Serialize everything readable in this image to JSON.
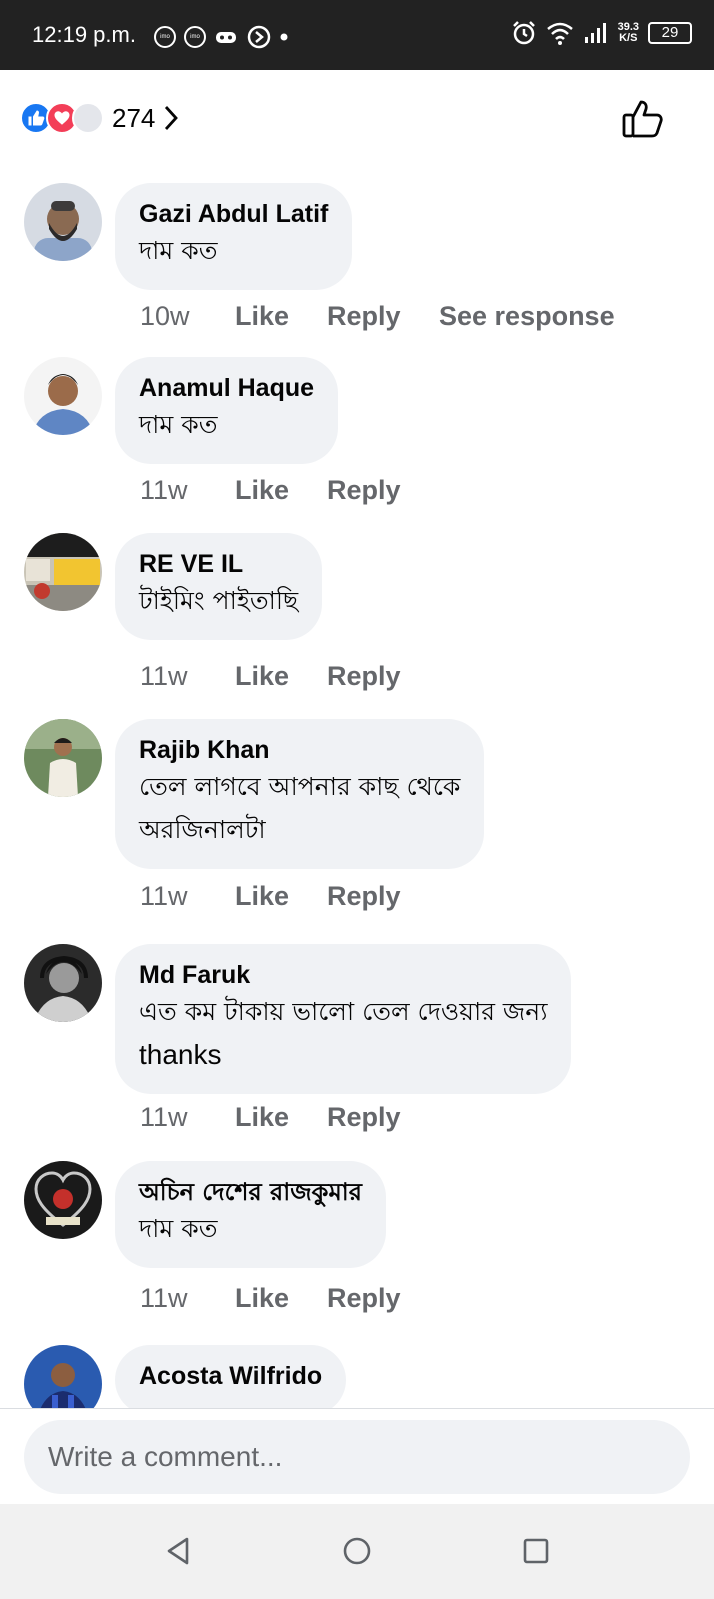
{
  "status_bar": {
    "time": "12:19 p.m.",
    "notif_icon_1": "imo",
    "notif_icon_2": "imo",
    "speed_top": "39.3",
    "speed_bottom": "K/S",
    "battery": "29",
    "icons": [
      "alarm-icon",
      "wifi-icon",
      "signal-icon",
      "battery-icon"
    ]
  },
  "reactions": {
    "count": "274",
    "types": [
      "like",
      "love"
    ]
  },
  "comments": [
    {
      "name": "Gazi Abdul Latif",
      "lines": [
        "দাম কত"
      ],
      "time": "10w",
      "like": "Like",
      "reply": "Reply",
      "see_response": "See response"
    },
    {
      "name": "Anamul Haque",
      "lines": [
        "দাম কত"
      ],
      "time": "11w",
      "like": "Like",
      "reply": "Reply"
    },
    {
      "name": "RE VE IL",
      "lines": [
        "টাইমিং পাইতাছি"
      ],
      "time": "11w",
      "like": "Like",
      "reply": "Reply"
    },
    {
      "name": "Rajib Khan",
      "lines": [
        "তেল লাগবে আপনার কাছ থেকে",
        "অরজিনালটা"
      ],
      "time": "11w",
      "like": "Like",
      "reply": "Reply"
    },
    {
      "name": "Md Faruk",
      "lines": [
        "এত কম টাকায় ভালো তেল দেওয়ার জন্য",
        "thanks"
      ],
      "time": "11w",
      "like": "Like",
      "reply": "Reply"
    },
    {
      "name": "অচিন দেশের রাজকুমার",
      "lines": [
        "দাম কত"
      ],
      "time": "11w",
      "like": "Like",
      "reply": "Reply"
    },
    {
      "name": "Acosta Wilfrido"
    }
  ],
  "composer": {
    "placeholder": "Write a comment..."
  },
  "colors": {
    "accent": "#1877f2",
    "love": "#f33e58",
    "bubble": "#f0f2f5",
    "muted": "#65676b"
  }
}
